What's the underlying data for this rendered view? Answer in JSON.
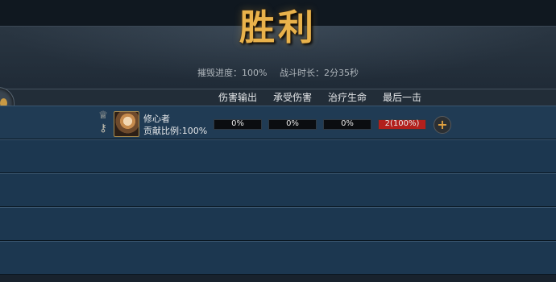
{
  "title": "胜利",
  "stats": {
    "destroy_progress": "摧毁进度：100%",
    "battle_duration": "战斗时长：2分35秒"
  },
  "columns": [
    "伤害输出",
    "承受伤害",
    "治疗生命",
    "最后一击"
  ],
  "player": {
    "name": "修心者",
    "contribution": "贡献比例:100%",
    "damage_output": "0%",
    "damage_taken": "0%",
    "healing": "0%",
    "last_hit": "2(100%)",
    "last_hit_fill": 1.0
  },
  "colors": {
    "title_gold": "#e9b24b",
    "row_blue": "#1c3750",
    "bar_red": "#b2201c"
  }
}
